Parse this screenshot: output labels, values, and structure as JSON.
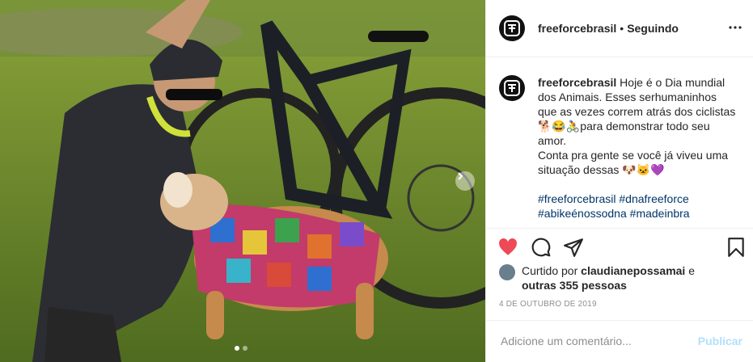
{
  "post": {
    "username": "freeforcebrasil",
    "separator": "•",
    "follow_label": "Seguindo",
    "caption": {
      "username": "freeforcebrasil",
      "line1": "Hoje é o Dia mundial dos Animais. Esses serhumaninhos que as vezes correm atrás dos ciclistas🐕😂🚴para demonstrar todo seu amor.",
      "line2": "Conta pra gente se você já viveu uma situação dessas 🐶🐱💜",
      "hashtag1": "#freeforcebrasil",
      "hashtag2": "#dnafreeforce",
      "hashtag3": "#abikeénossodna",
      "hashtag4": "#madeinbra"
    },
    "likes": {
      "prefix": "Curtido por",
      "user": "claudianepossamai",
      "connector": "e",
      "others": "outras 355 pessoas"
    },
    "date": "4 DE OUTUBRO DE 2019",
    "comment_placeholder": "Adicione um comentário...",
    "publish_label": "Publicar",
    "icons": [
      "heart-icon",
      "comment-icon",
      "share-icon",
      "bookmark-icon",
      "more-icon",
      "chevron-right-icon"
    ],
    "colors": {
      "like_red": "#ed4956",
      "link_blue": "#003569",
      "publish_disabled": "#b2dffc",
      "meta_gray": "#8e8e8e"
    }
  }
}
